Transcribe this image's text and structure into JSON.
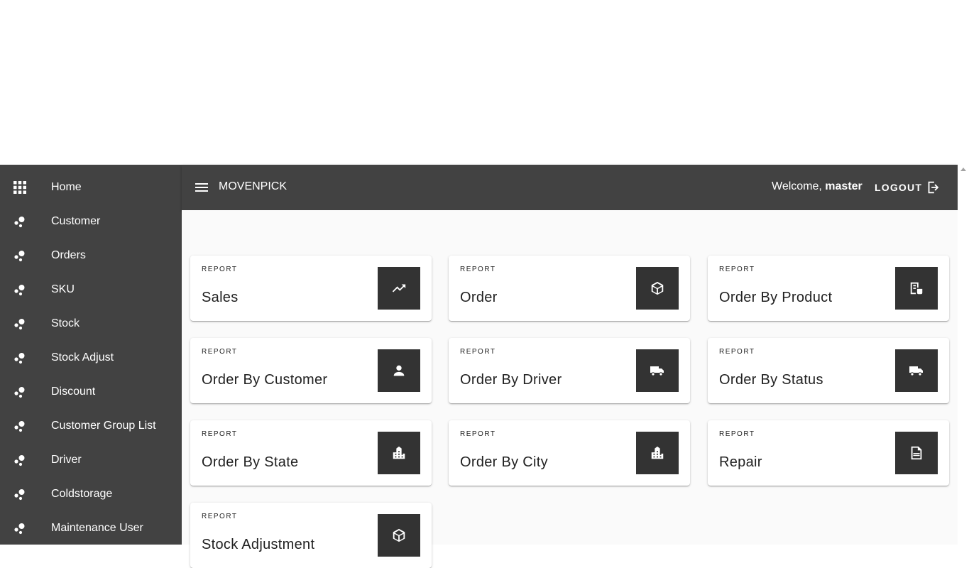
{
  "sidebar": {
    "items": [
      {
        "label": "Home",
        "icon": "apps-grid-icon"
      },
      {
        "label": "Customer",
        "icon": "bubble-chart-icon"
      },
      {
        "label": "Orders",
        "icon": "bubble-chart-icon"
      },
      {
        "label": "SKU",
        "icon": "bubble-chart-icon"
      },
      {
        "label": "Stock",
        "icon": "bubble-chart-icon"
      },
      {
        "label": "Stock Adjust",
        "icon": "bubble-chart-icon"
      },
      {
        "label": "Discount",
        "icon": "bubble-chart-icon"
      },
      {
        "label": "Customer Group List",
        "icon": "bubble-chart-icon"
      },
      {
        "label": "Driver",
        "icon": "bubble-chart-icon"
      },
      {
        "label": "Coldstorage",
        "icon": "bubble-chart-icon"
      },
      {
        "label": "Maintenance User",
        "icon": "bubble-chart-icon"
      }
    ]
  },
  "topbar": {
    "menu_icon": "hamburger-menu-icon",
    "brand": "MOVENPICK",
    "welcome_prefix": "Welcome,",
    "username": "master",
    "logout_label": "LOGOUT",
    "logout_icon": "logout-icon"
  },
  "cards": [
    {
      "overline": "REPORT",
      "title": "Sales",
      "icon": "trending-up-icon"
    },
    {
      "overline": "REPORT",
      "title": "Order",
      "icon": "package-icon"
    },
    {
      "overline": "REPORT",
      "title": "Order By Product",
      "icon": "receipt-icon"
    },
    {
      "overline": "REPORT",
      "title": "Order By Customer",
      "icon": "person-icon"
    },
    {
      "overline": "REPORT",
      "title": "Order By Driver",
      "icon": "truck-icon"
    },
    {
      "overline": "REPORT",
      "title": "Order By Status",
      "icon": "truck-icon"
    },
    {
      "overline": "REPORT",
      "title": "Order By State",
      "icon": "city-icon"
    },
    {
      "overline": "REPORT",
      "title": "Order By City",
      "icon": "city-icon"
    },
    {
      "overline": "REPORT",
      "title": "Repair",
      "icon": "file-document-icon"
    },
    {
      "overline": "REPORT",
      "title": "Stock Adjustment",
      "icon": "package-icon"
    }
  ],
  "colors": {
    "sidebar_bg": "#424242",
    "topbar_bg": "#424242",
    "main_bg": "#fafafa",
    "card_icon_bg": "#333333",
    "text_on_dark": "#ffffff"
  }
}
